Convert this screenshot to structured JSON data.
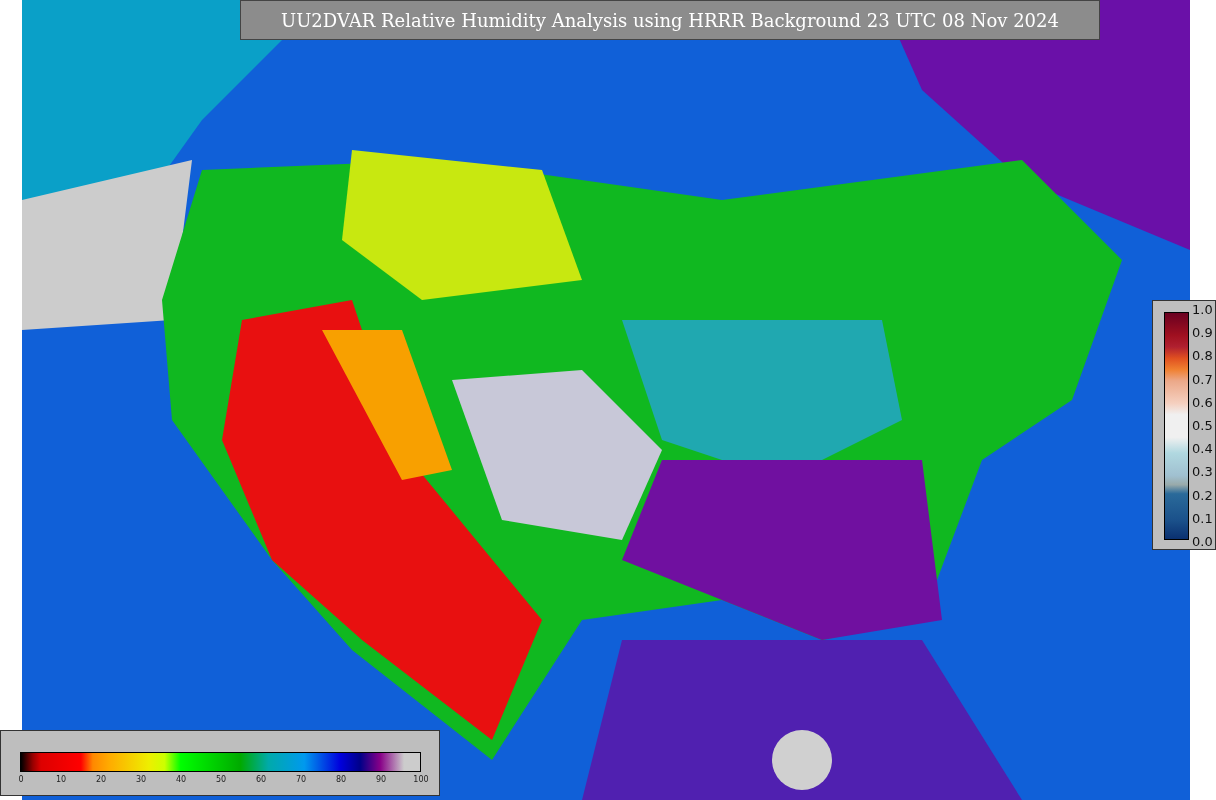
{
  "title": "UU2DVAR Relative Humidity Analysis using HRRR Background 23 UTC 08 Nov 2024",
  "humidity_scale": {
    "ticks": [
      "0",
      "10",
      "20",
      "30",
      "40",
      "50",
      "60",
      "70",
      "80",
      "90",
      "100"
    ]
  },
  "ratio_scale": {
    "ticks": [
      "1.0",
      "0.9",
      "0.8",
      "0.7",
      "0.6",
      "0.5",
      "0.4",
      "0.3",
      "0.2",
      "0.1",
      "0.0"
    ]
  }
}
